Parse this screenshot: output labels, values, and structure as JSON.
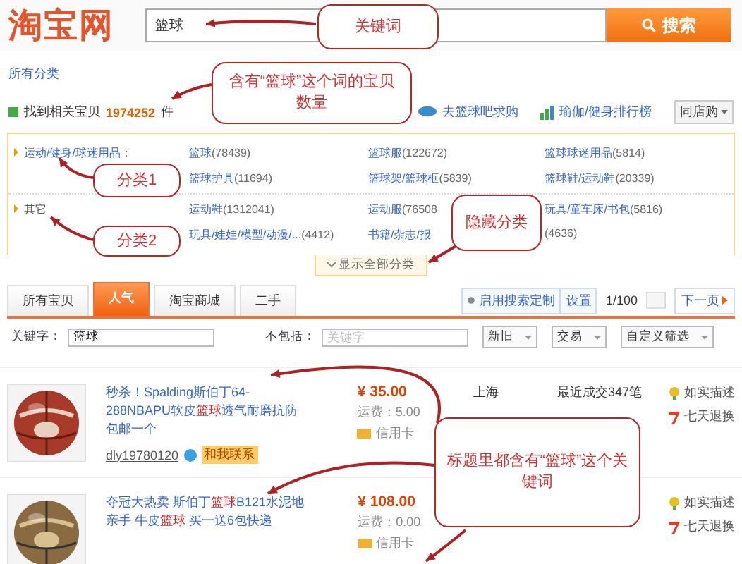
{
  "header": {
    "logo": "淘宝网",
    "search_value": "篮球",
    "search_button": "搜索"
  },
  "breadcrumb": "所有分类",
  "result_count": {
    "prefix": "找到相关宝贝",
    "count": "1974252",
    "suffix": "件"
  },
  "links": [
    "去篮球吧求购",
    "瑜伽/健身排行榜"
  ],
  "shop_select": "同店购",
  "category_groups": [
    {
      "name": "运动/健身/球迷用品：",
      "items": [
        {
          "label": "篮球",
          "count": "(78439)"
        },
        {
          "label": "篮球服",
          "count": "(122672)"
        },
        {
          "label": "篮球球迷用品",
          "count": "(5814)"
        },
        {
          "label": "篮球护具",
          "count": "(11694)"
        },
        {
          "label": "篮球架/篮球框",
          "count": "(5839)"
        },
        {
          "label": "篮球鞋/运动鞋",
          "count": "(20339)"
        }
      ]
    },
    {
      "name": "其它",
      "items": [
        {
          "label": "运动鞋",
          "count": "(1312041)"
        },
        {
          "label": "运动服",
          "count": "(76508"
        },
        {
          "label": "玩具/童车床/书包",
          "count": "(5816)"
        },
        {
          "label": "玩具/娃娃/模型/动漫/...",
          "count": "(4412)"
        },
        {
          "label": "书籍/杂志/报"
        },
        {
          "count": "(4636)"
        }
      ]
    }
  ],
  "show_all": "显示全部分类",
  "tabs": [
    {
      "label": "所有宝贝",
      "selected": false
    },
    {
      "label": "人气",
      "selected": true
    },
    {
      "label": "淘宝商城",
      "selected": false
    },
    {
      "label": "二手",
      "selected": false
    }
  ],
  "customize": "启用搜索定制",
  "settings": "设置",
  "page": "1/100",
  "next": "下一页",
  "filters": {
    "keyword_label": "关键字：",
    "keyword": "篮球",
    "exclude_label": "不包括：",
    "exclude_placeholder": "关键字",
    "selects": [
      "新旧",
      "交易",
      "自定义筛选"
    ]
  },
  "items": [
    {
      "title_parts": [
        {
          "text": "秒杀！Spalding斯伯丁64-288NBAPU软皮",
          "highlight": false
        },
        {
          "text": "篮球",
          "highlight": true
        },
        {
          "text": "透气耐磨抗防包邮一个",
          "highlight": false
        }
      ],
      "seller": "dly19780120",
      "contact": "和我联系",
      "price": "¥ 35.00",
      "shipping": "运费：5.00",
      "payment": "信用卡",
      "location": "上海",
      "sales": "最近成交347笔",
      "services": [
        "如实描述",
        "七天退换"
      ]
    },
    {
      "title_parts": [
        {
          "text": "夺冠大热卖 斯伯丁",
          "highlight": false
        },
        {
          "text": "篮球",
          "highlight": true
        },
        {
          "text": "B121水泥地亲手 牛皮",
          "highlight": false
        },
        {
          "text": "篮球",
          "highlight": true
        },
        {
          "text": " 买一送6包快递",
          "highlight": false
        }
      ],
      "price": "¥ 108.00",
      "shipping": "运费：0.00",
      "payment": "信用卡",
      "services": [
        "如实描述",
        "七天退换"
      ]
    }
  ],
  "annotations": [
    {
      "text": "关键词"
    },
    {
      "text": "含有“篮球”这个词的宝贝数量"
    },
    {
      "text": "分类1"
    },
    {
      "text": "分类2"
    },
    {
      "text": "隐藏分类"
    },
    {
      "text": "标题里都含有“篮球”这个关键词"
    }
  ]
}
